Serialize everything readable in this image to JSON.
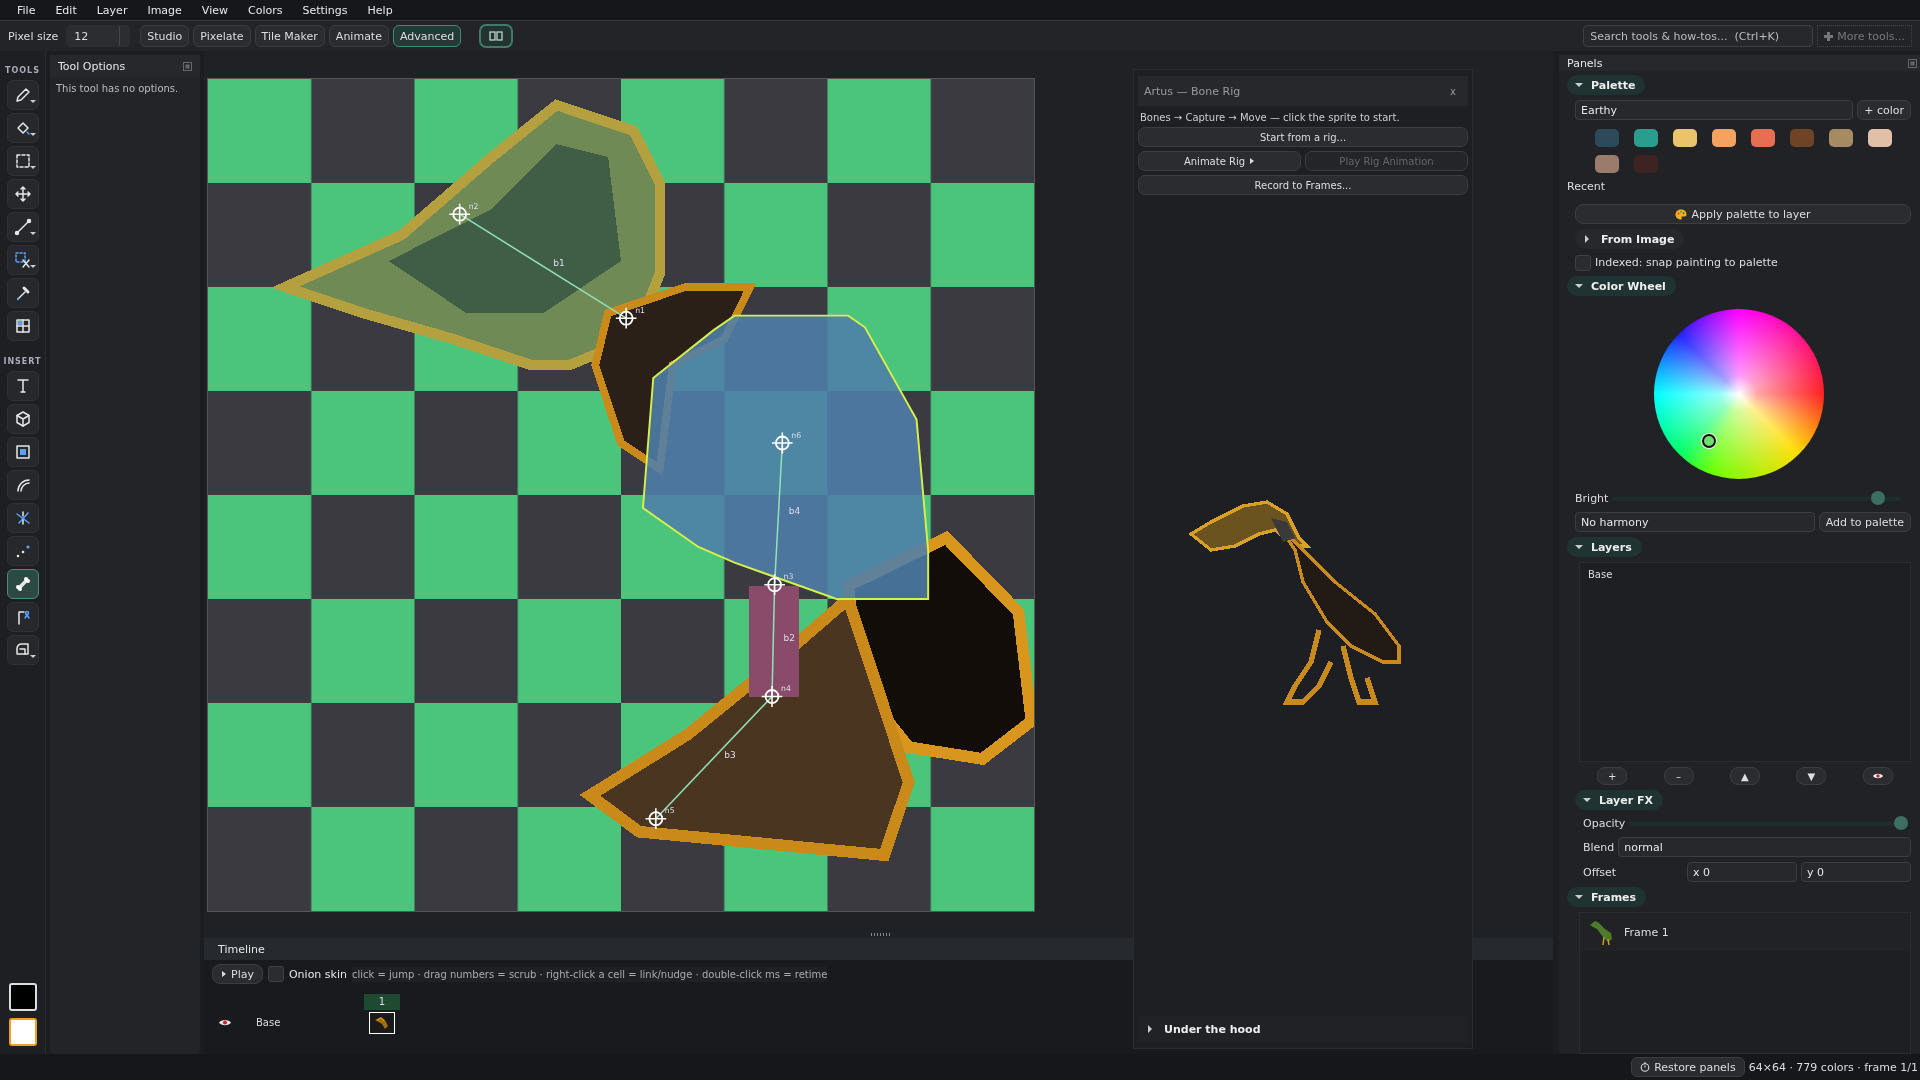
{
  "menu": [
    {
      "label": "File"
    },
    {
      "label": "Edit"
    },
    {
      "label": "Layer"
    },
    {
      "label": "Image"
    },
    {
      "label": "View"
    },
    {
      "label": "Colors"
    },
    {
      "label": "Settings"
    },
    {
      "label": "Help"
    }
  ],
  "toolbar": {
    "pixel_size_label": "Pixel size",
    "pixel_size": "12",
    "modes": [
      {
        "label": "Studio",
        "selected": false
      },
      {
        "label": "Pixelate",
        "selected": false
      },
      {
        "label": "Tile Maker",
        "selected": false
      },
      {
        "label": "Animate",
        "selected": false
      },
      {
        "label": "Advanced",
        "selected": true
      }
    ],
    "search": {
      "placeholder": "Search tools & how-tos...  (Ctrl+K)"
    },
    "more_tools": "More tools..."
  },
  "tools": {
    "heading": "TOOLS",
    "items": [
      {
        "kind": "pencil",
        "has_menu": true,
        "selected": false
      },
      {
        "kind": "fill",
        "has_menu": true,
        "selected": false
      },
      {
        "kind": "select",
        "has_menu": true,
        "selected": false
      },
      {
        "kind": "move",
        "has_menu": false,
        "selected": false
      },
      {
        "kind": "line",
        "has_menu": true,
        "selected": false
      },
      {
        "kind": "cut",
        "has_menu": true,
        "selected": false
      },
      {
        "kind": "picker",
        "has_menu": false,
        "selected": false
      },
      {
        "kind": "tiles",
        "has_menu": false,
        "selected": false
      }
    ]
  },
  "insert": {
    "heading": "INSERT",
    "items": [
      {
        "kind": "text",
        "has_menu": false,
        "selected": false
      },
      {
        "kind": "cube",
        "has_menu": false,
        "selected": false
      },
      {
        "kind": "film",
        "has_menu": false,
        "selected": false
      },
      {
        "kind": "curve",
        "has_menu": false,
        "selected": false
      },
      {
        "kind": "sparkle",
        "has_menu": false,
        "selected": false
      },
      {
        "kind": "spray",
        "has_menu": false,
        "selected": false
      },
      {
        "kind": "bone",
        "has_menu": false,
        "selected": true
      },
      {
        "kind": "lamp",
        "has_menu": false,
        "selected": false
      },
      {
        "kind": "transform",
        "has_menu": true,
        "selected": false
      }
    ]
  },
  "color_swatches": [
    {
      "color": "#000000",
      "selected": false
    },
    {
      "color": "#ffffff",
      "selected": true
    }
  ],
  "tool_options": {
    "title": "Tool Options",
    "message": "This tool has no options."
  },
  "canvas": {
    "bones": [
      {
        "label": "b1"
      },
      {
        "label": "b4"
      },
      {
        "label": "b2"
      },
      {
        "label": "b3"
      }
    ],
    "joints": [
      {
        "label": "n2"
      },
      {
        "label": "n1"
      },
      {
        "label": "n6"
      },
      {
        "label": "n3"
      },
      {
        "label": "n4"
      },
      {
        "label": "n5"
      }
    ]
  },
  "rig_panel": {
    "title": "Artus — Bone Rig",
    "close": "x",
    "hint": "Bones → Capture → Move — click the sprite to start.",
    "buttons": [
      {
        "label": "Start from a rig...",
        "kind": "wide",
        "disabled": false
      },
      {
        "label": "Animate Rig",
        "kind": "menu",
        "disabled": false
      },
      {
        "label": "Play Rig Animation",
        "kind": "half",
        "disabled": true
      },
      {
        "label": "Record to Frames...",
        "kind": "wide",
        "disabled": false
      }
    ],
    "footer": {
      "label": "Under the hood",
      "expanded": false
    }
  },
  "timeline": {
    "title": "Timeline",
    "play": "Play",
    "onion_skin": {
      "label": "Onion skin",
      "checked": false
    },
    "hint": "click = jump · drag numbers = scrub · right-click a cell = link/nudge · double-click ms = retime",
    "frames": [
      {
        "label": "1",
        "selected": true
      }
    ],
    "tracks": [
      {
        "name": "Base",
        "visible": true
      }
    ]
  },
  "panels": {
    "title": "Panels",
    "palette": {
      "title": "Palette",
      "expanded": true,
      "name": "Earthy",
      "add": "+ color",
      "swatches": [
        {
          "color": "#2d4a5a"
        },
        {
          "color": "#2a9d8f"
        },
        {
          "color": "#e9c46a"
        },
        {
          "color": "#f4a261"
        },
        {
          "color": "#e76f51"
        },
        {
          "color": "#6f4325"
        },
        {
          "color": "#a68a64"
        },
        {
          "color": "#e0c1a8"
        },
        {
          "color": "#9b7b6b"
        },
        {
          "color": "#3d2422"
        }
      ],
      "recent": "Recent",
      "apply": "Apply palette to layer",
      "from_image": {
        "label": "From Image",
        "expanded": false
      },
      "indexed": {
        "label": "Indexed: snap painting to palette",
        "checked": false
      }
    },
    "color_wheel": {
      "title": "Color Wheel",
      "expanded": true,
      "bright_label": "Bright",
      "level": 0.92,
      "harmony": "No harmony",
      "add": "Add to palette"
    },
    "layers": {
      "title": "Layers",
      "expanded": true,
      "items": [
        {
          "name": "Base",
          "selected": false
        }
      ],
      "buttons": [
        {
          "label": "+"
        },
        {
          "label": "–"
        },
        {
          "label": "▲"
        },
        {
          "label": "▼"
        }
      ]
    },
    "layer_fx": {
      "title": "Layer FX",
      "expanded": true,
      "opacity_label": "Opacity",
      "level": 1,
      "blend_label": "Blend",
      "blend": "normal",
      "offset_label": "Offset",
      "x": "x 0",
      "y": "y 0"
    },
    "frames": {
      "title": "Frames",
      "expanded": true,
      "items": [
        {
          "name": "Frame 1",
          "selected": false
        }
      ]
    }
  },
  "status": {
    "restore": "Restore panels",
    "info": "64×64 · 779 colors · frame 1/1"
  }
}
